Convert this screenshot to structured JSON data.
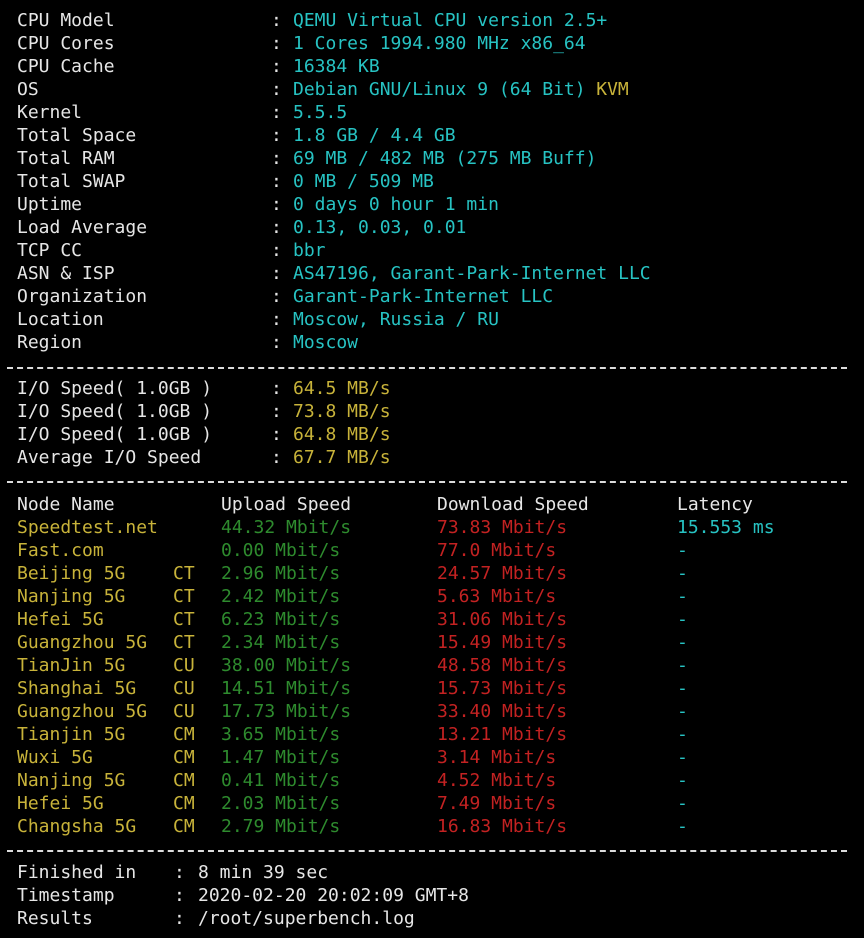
{
  "colors": {
    "background": "#000000",
    "text": "#e6e6e6",
    "cyan": "#27c3c3",
    "yellow": "#c8b33a",
    "green": "#2e8b2e",
    "red": "#c32222"
  },
  "separator": ":",
  "system_info": [
    {
      "label": "CPU Model",
      "value": "QEMU Virtual CPU version 2.5+",
      "value2": ""
    },
    {
      "label": "CPU Cores",
      "value": "1 Cores 1994.980 MHz x86_64",
      "value2": ""
    },
    {
      "label": "CPU Cache",
      "value": "16384 KB",
      "value2": ""
    },
    {
      "label": "OS",
      "value": "Debian GNU/Linux 9 (64 Bit)",
      "value2": "KVM"
    },
    {
      "label": "Kernel",
      "value": "5.5.5",
      "value2": ""
    },
    {
      "label": "Total Space",
      "value": "1.8 GB / 4.4 GB",
      "value2": ""
    },
    {
      "label": "Total RAM",
      "value": "69 MB / 482 MB (275 MB Buff)",
      "value2": ""
    },
    {
      "label": "Total SWAP",
      "value": "0 MB / 509 MB",
      "value2": ""
    },
    {
      "label": "Uptime",
      "value": "0 days 0 hour 1 min",
      "value2": ""
    },
    {
      "label": "Load Average",
      "value": "0.13, 0.03, 0.01",
      "value2": ""
    },
    {
      "label": "TCP CC",
      "value": "bbr",
      "value2": ""
    },
    {
      "label": "ASN & ISP",
      "value": "AS47196, Garant-Park-Internet LLC",
      "value2": ""
    },
    {
      "label": "Organization",
      "value": "Garant-Park-Internet LLC",
      "value2": ""
    },
    {
      "label": "Location",
      "value": "Moscow, Russia / RU",
      "value2": ""
    },
    {
      "label": "Region",
      "value": "Moscow",
      "value2": ""
    }
  ],
  "io_speed": [
    {
      "label": "I/O Speed( 1.0GB )",
      "value": "64.5 MB/s"
    },
    {
      "label": "I/O Speed( 1.0GB )",
      "value": "73.8 MB/s"
    },
    {
      "label": "I/O Speed( 1.0GB )",
      "value": "64.8 MB/s"
    },
    {
      "label": "Average I/O Speed",
      "value": "67.7 MB/s"
    }
  ],
  "speedtest": {
    "headers": {
      "node": "Node Name",
      "upload": "Upload Speed",
      "download": "Download Speed",
      "latency": "Latency"
    },
    "rows": [
      {
        "node": "Speedtest.net",
        "isp": "",
        "upload": "44.32 Mbit/s",
        "download": "73.83 Mbit/s",
        "latency": "15.553 ms"
      },
      {
        "node": "Fast.com",
        "isp": "",
        "upload": "0.00 Mbit/s",
        "download": "77.0 Mbit/s",
        "latency": "-"
      },
      {
        "node": "Beijing 5G",
        "isp": "CT",
        "upload": "2.96 Mbit/s",
        "download": "24.57 Mbit/s",
        "latency": "-"
      },
      {
        "node": "Nanjing 5G",
        "isp": "CT",
        "upload": "2.42 Mbit/s",
        "download": "5.63 Mbit/s",
        "latency": "-"
      },
      {
        "node": "Hefei 5G",
        "isp": "CT",
        "upload": "6.23 Mbit/s",
        "download": "31.06 Mbit/s",
        "latency": "-"
      },
      {
        "node": "Guangzhou 5G",
        "isp": "CT",
        "upload": "2.34 Mbit/s",
        "download": "15.49 Mbit/s",
        "latency": "-"
      },
      {
        "node": "TianJin 5G",
        "isp": "CU",
        "upload": "38.00 Mbit/s",
        "download": "48.58 Mbit/s",
        "latency": "-"
      },
      {
        "node": "Shanghai 5G",
        "isp": "CU",
        "upload": "14.51 Mbit/s",
        "download": "15.73 Mbit/s",
        "latency": "-"
      },
      {
        "node": "Guangzhou 5G",
        "isp": "CU",
        "upload": "17.73 Mbit/s",
        "download": "33.40 Mbit/s",
        "latency": "-"
      },
      {
        "node": "Tianjin 5G",
        "isp": "CM",
        "upload": "3.65 Mbit/s",
        "download": "13.21 Mbit/s",
        "latency": "-"
      },
      {
        "node": "Wuxi 5G",
        "isp": "CM",
        "upload": "1.47 Mbit/s",
        "download": "3.14 Mbit/s",
        "latency": "-"
      },
      {
        "node": "Nanjing 5G",
        "isp": "CM",
        "upload": "0.41 Mbit/s",
        "download": "4.52 Mbit/s",
        "latency": "-"
      },
      {
        "node": "Hefei 5G",
        "isp": "CM",
        "upload": "2.03 Mbit/s",
        "download": "7.49 Mbit/s",
        "latency": "-"
      },
      {
        "node": "Changsha 5G",
        "isp": "CM",
        "upload": "2.79 Mbit/s",
        "download": "16.83 Mbit/s",
        "latency": "-"
      }
    ]
  },
  "summary": [
    {
      "label": "Finished in",
      "value": "8 min 39 sec"
    },
    {
      "label": "Timestamp",
      "value": "2020-02-20 20:02:09 GMT+8"
    },
    {
      "label": "Results",
      "value": "/root/superbench.log"
    }
  ]
}
